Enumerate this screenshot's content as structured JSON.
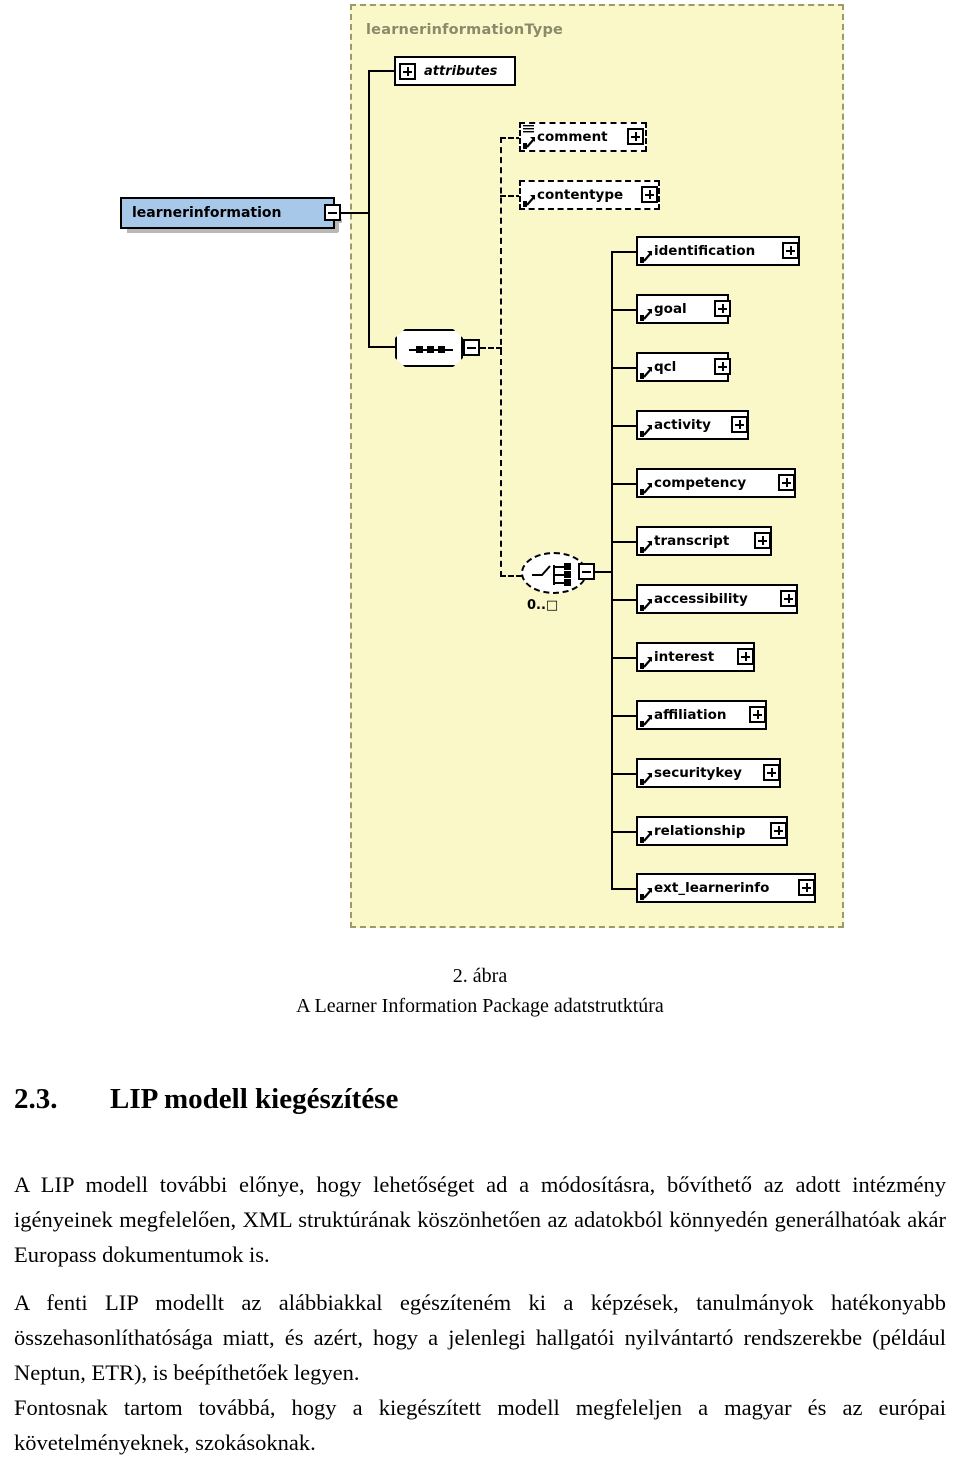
{
  "diagram": {
    "type_label": "learnerinformationType",
    "root_element": {
      "label": "learnerinformation",
      "expander": "minus"
    },
    "attributes_node": {
      "label": "attributes",
      "expander": "plus"
    },
    "sequence_node": {
      "name": "sequence-compositor",
      "expander": "minus"
    },
    "choice_node": {
      "name": "choice-compositor",
      "expander": "minus",
      "cardinality": "0..□"
    },
    "optional_elements": [
      {
        "label": "comment",
        "expander": "plus"
      },
      {
        "label": "contentype",
        "expander": "plus"
      }
    ],
    "elements": [
      {
        "label": "identification",
        "expander": "plus"
      },
      {
        "label": "goal",
        "expander": "plus"
      },
      {
        "label": "qcl",
        "expander": "plus"
      },
      {
        "label": "activity",
        "expander": "plus"
      },
      {
        "label": "competency",
        "expander": "plus"
      },
      {
        "label": "transcript",
        "expander": "plus"
      },
      {
        "label": "accessibility",
        "expander": "plus"
      },
      {
        "label": "interest",
        "expander": "plus"
      },
      {
        "label": "affiliation",
        "expander": "plus"
      },
      {
        "label": "securitykey",
        "expander": "plus"
      },
      {
        "label": "relationship",
        "expander": "plus"
      },
      {
        "label": "ext_learnerinfo",
        "expander": "plus"
      }
    ],
    "colors": {
      "type_background": "#faf8c8",
      "type_border": "#9a9a6a",
      "root_fill": "#a8c8ea",
      "node_fill": "#ffffff",
      "shadow": "#b8b8b8"
    }
  },
  "caption": {
    "figure_number": "2. ábra",
    "figure_title": "A Learner Information Package adatstrutktúra"
  },
  "section": {
    "number": "2.3.",
    "title": "LIP modell kiegészítése"
  },
  "paragraphs": {
    "p1": "A LIP modell további előnye, hogy lehetőséget ad a módosításra, bővíthető az adott intézmény igényeinek megfelelően, XML struktúrának köszönhetően az adatokból könnyedén generálhatóak akár Europass dokumentumok is.",
    "p2": "A fenti LIP modellt az alábbiakkal egészíteném ki a képzések, tanulmányok hatékonyabb összehasonlíthatósága miatt, és azért, hogy a jelenlegi hallgatói nyilvántartó rendszerekbe (például Neptun, ETR), is beépíthetőek legyen.",
    "p3": "Fontosnak tartom továbbá, hogy a kiegészített modell megfeleljen a magyar és az európai követelményeknek, szokásoknak."
  }
}
